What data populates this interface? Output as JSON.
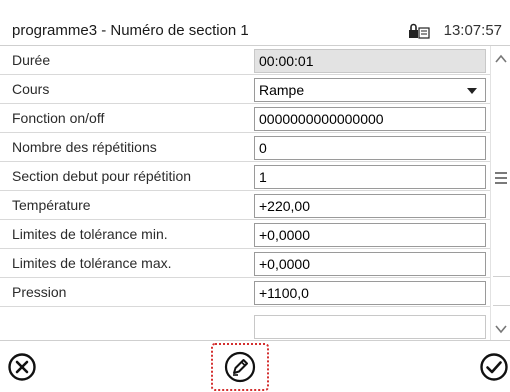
{
  "header": {
    "title": "programme3 - Numéro de section 1",
    "time": "13:07:57",
    "lock_icon": "lock-icon"
  },
  "rows": [
    {
      "label": "Durée",
      "value": "00:00:01",
      "readonly": true
    },
    {
      "label": "Cours",
      "value": "Rampe",
      "dropdown": true
    },
    {
      "label": "Fonction on/off",
      "value": "0000000000000000"
    },
    {
      "label": "Nombre des répétitions",
      "value": "0"
    },
    {
      "label": "Section debut pour répétition",
      "value": "1"
    },
    {
      "label": "Température",
      "value": "+220,00"
    },
    {
      "label": "Limites de tolérance min.",
      "value": "+0,0000"
    },
    {
      "label": "Limites de tolérance max.",
      "value": "+0,0000"
    },
    {
      "label": "Pression",
      "value": "+1100,0"
    }
  ],
  "footer": {
    "cancel_icon": "cancel-icon",
    "edit_icon": "edit-icon",
    "ok_icon": "confirm-icon"
  },
  "colors": {
    "highlight": "#d32f2f",
    "readonly_bg": "#e3e3e3"
  }
}
